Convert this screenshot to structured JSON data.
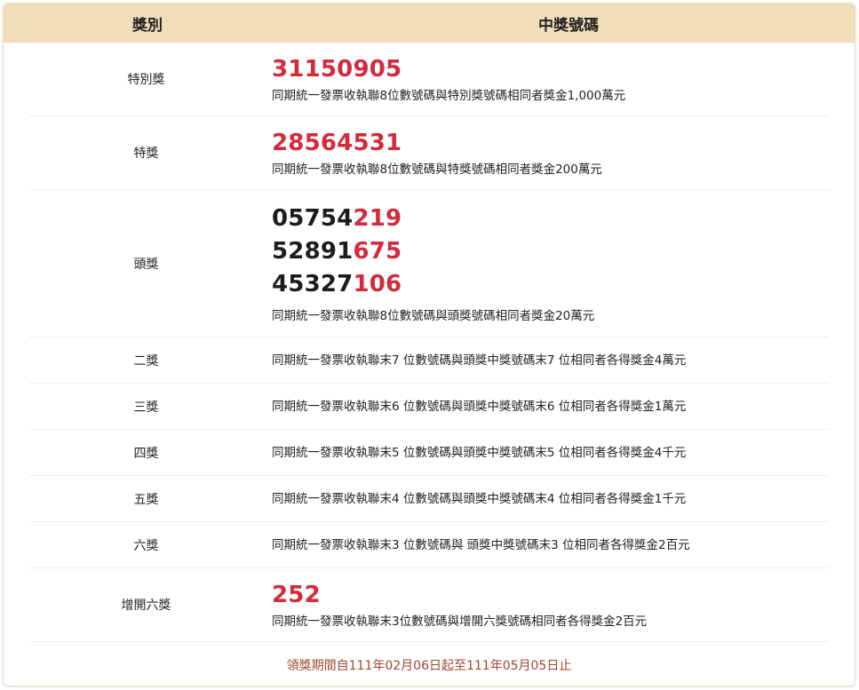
{
  "header": {
    "col_prize": "獎別",
    "col_numbers": "中獎號碼"
  },
  "rows": {
    "special": {
      "name": "特別獎",
      "number": "31150905",
      "desc": "同期統一發票收執聯8位數號碼與特別獎號碼相同者獎金1,000萬元"
    },
    "grand": {
      "name": "特獎",
      "number": "28564531",
      "desc": "同期統一發票收執聯8位數號碼與特獎號碼相同者獎金200萬元"
    },
    "first": {
      "name": "頭獎",
      "numbers": [
        {
          "head": "05754",
          "tail": "219"
        },
        {
          "head": "52891",
          "tail": "675"
        },
        {
          "head": "45327",
          "tail": "106"
        }
      ],
      "desc": "同期統一發票收執聯8位數號碼與頭獎號碼相同者獎金20萬元"
    },
    "second": {
      "name": "二獎",
      "desc": "同期統一發票收執聯末7 位數號碼與頭獎中獎號碼末7 位相同者各得獎金4萬元"
    },
    "third": {
      "name": "三獎",
      "desc": "同期統一發票收執聯末6 位數號碼與頭獎中獎號碼末6 位相同者各得獎金1萬元"
    },
    "fourth": {
      "name": "四獎",
      "desc": "同期統一發票收執聯末5 位數號碼與頭獎中獎號碼末5 位相同者各得獎金4千元"
    },
    "fifth": {
      "name": "五獎",
      "desc": "同期統一發票收執聯末4 位數號碼與頭獎中獎號碼末4 位相同者各得獎金1千元"
    },
    "sixth": {
      "name": "六獎",
      "desc": "同期統一發票收執聯末3 位數號碼與 頭獎中獎號碼末3 位相同者各得獎金2百元"
    },
    "extra_sixth": {
      "name": "增開六獎",
      "number": "252",
      "desc": "同期統一發票收執聯末3位數號碼與增開六獎號碼相同者各得獎金2百元"
    }
  },
  "footer": {
    "claim_period": "領獎期間自111年02月06日起至111年05月05日止"
  },
  "colors": {
    "accent_red": "#d12b3c",
    "header_bg": "#f1ddb8",
    "footer_text": "#a0452f"
  }
}
